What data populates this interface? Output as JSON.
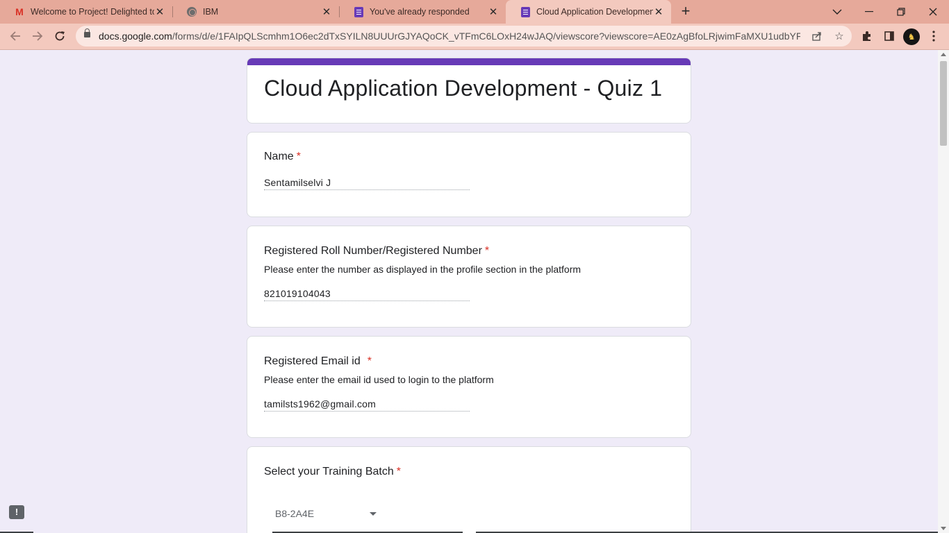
{
  "browser": {
    "tabs": [
      {
        "title": "Welcome to Project! Delighted to",
        "icon": "gmail-icon"
      },
      {
        "title": "IBM",
        "icon": "globe-icon"
      },
      {
        "title": "You've already responded",
        "icon": "google-forms-icon"
      },
      {
        "title": "Cloud Application Development",
        "icon": "google-forms-icon",
        "active": true
      }
    ],
    "new_tab": "+",
    "url_host": "docs.google.com",
    "url_rest": "/forms/d/e/1FAIpQLScmhm1O6ec2dTxSYILN8UUUrGJYAQoCK_vTFmC6LOxH24wJAQ/viewscore?viewscore=AE0zAgBfoLRjwimFaMXU1udbYFvR16..."
  },
  "form": {
    "title": "Cloud Application Development - Quiz 1",
    "accent_color": "#673ab7",
    "required_mark": "*",
    "questions": {
      "name": {
        "label": "Name",
        "answer": "Sentamilselvi J"
      },
      "roll": {
        "label": "Registered Roll Number/Registered Number",
        "help": "Please enter the number as displayed in the profile section in the platform",
        "answer": "821019104043"
      },
      "email": {
        "label": "Registered Email id",
        "help": "Please enter the email id used to login to the platform",
        "answer": "tamilsts1962@gmail.com"
      },
      "batch": {
        "label": "Select your Training Batch",
        "selected": "B8-2A4E"
      }
    }
  },
  "feedback_button": "!"
}
